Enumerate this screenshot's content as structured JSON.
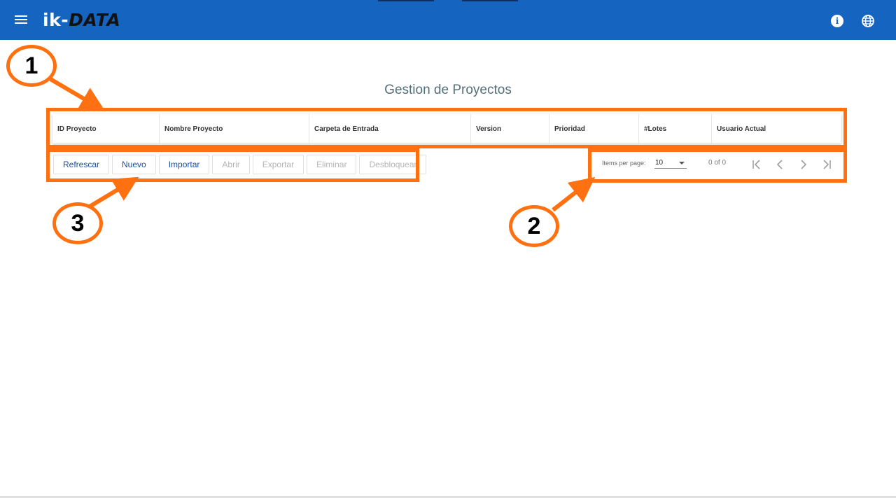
{
  "app": {
    "logo_ik": "ik",
    "logo_dash": "-",
    "logo_data": "DATA"
  },
  "icons": {
    "menu": "hamburger-icon",
    "info": "info-icon",
    "language": "globe-icon",
    "info_glyph": "i"
  },
  "page": {
    "title": "Gestion de Proyectos"
  },
  "table": {
    "columns": [
      "ID Proyecto",
      "Nombre Proyecto",
      "Carpeta de Entrada",
      "Version",
      "Prioridad",
      "#Lotes",
      "Usuario Actual"
    ]
  },
  "actions": {
    "refresh": "Refrescar",
    "new": "Nuevo",
    "import": "Importar",
    "open": "Abrir",
    "export": "Exportar",
    "delete": "Eliminar",
    "unlock": "Desbloquear"
  },
  "paginator": {
    "items_per_page_label": "Items per page:",
    "page_size": "10",
    "range": "0 of 0"
  },
  "annotations": {
    "marker_1": "1",
    "marker_2": "2",
    "marker_3": "3"
  },
  "colors": {
    "topbar": "#1565c0",
    "annotation": "#ff7010",
    "title": "#546e7a",
    "button_enabled": "#1a4fa3",
    "button_disabled": "#b5b5b5"
  }
}
